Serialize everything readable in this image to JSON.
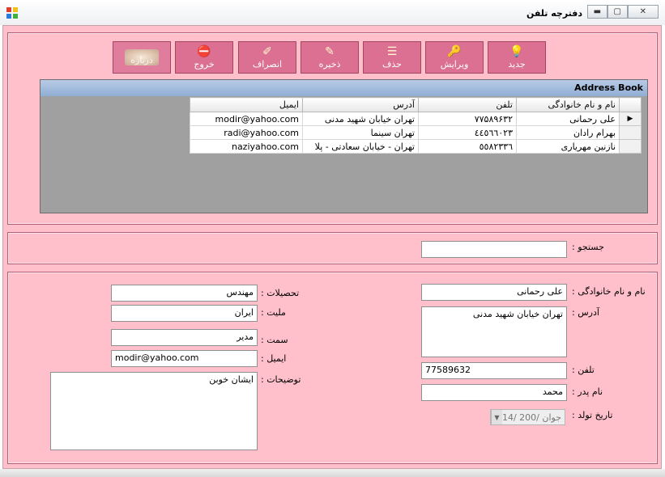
{
  "window": {
    "title": "دفترچه تلفن",
    "buttons": {
      "minimize": "▬",
      "maximize": "▢",
      "close": "✕"
    }
  },
  "toolbar": {
    "buttons": [
      {
        "label": "جدید",
        "icon": "lightbulb-icon",
        "glyph": "💡"
      },
      {
        "label": "ویرایش",
        "icon": "key-icon",
        "glyph": "🔑"
      },
      {
        "label": "حذف",
        "icon": "delete-list-icon",
        "glyph": "☰"
      },
      {
        "label": "ذخیره",
        "icon": "save-icon",
        "glyph": "✎"
      },
      {
        "label": "انصراف",
        "icon": "cancel-icon",
        "glyph": "✐"
      },
      {
        "label": "خروج",
        "icon": "exit-icon",
        "glyph": "⛔"
      },
      {
        "label": "درباره",
        "icon": "about-icon",
        "glyph": ""
      }
    ]
  },
  "grid": {
    "caption": "Address Book",
    "columns": [
      "نام و نام خانوادگی",
      "تلفن",
      "آدرس",
      "ایمیل"
    ],
    "rows": [
      [
        "علی رحمانی",
        "۷۷۵۸۹۶۳۲",
        "تهران خیابان شهید مدنی",
        "modir@yahoo.com"
      ],
      [
        "بهرام رادان",
        "٤٤٥٦٦٠٢٣",
        "تهران سینما",
        "radi@yahoo.com"
      ],
      [
        "نازنین مهریاری",
        "٥٥٨٢٣٣٦",
        "تهران - خیابان سعادتی - پلا",
        "naziyahoo.com"
      ]
    ],
    "selected_row_marker": "▶"
  },
  "search": {
    "label": "جستجو :",
    "value": ""
  },
  "form": {
    "fullname": {
      "label": "نام و نام خانوادگی :",
      "value": "علی رحمانی"
    },
    "address": {
      "label": "آدرس :",
      "value": "تهران خیابان شهید مدنی"
    },
    "phone": {
      "label": "تلفن :",
      "value": "77589632"
    },
    "father": {
      "label": "نام پدر :",
      "value": "محمد"
    },
    "birthdate": {
      "label": "تاریخ تولد :",
      "value": "14/  جوان  /200"
    },
    "education": {
      "label": "تحصیلات :",
      "value": "مهندس"
    },
    "nationality": {
      "label": "ملیت :",
      "value": "ایران"
    },
    "position": {
      "label": "سمت :",
      "value": "مدیر"
    },
    "email": {
      "label": "ایمیل :",
      "value": "modir@yahoo.com"
    },
    "notes": {
      "label": "توضیحات :",
      "value": "ایشان خوبن"
    }
  }
}
